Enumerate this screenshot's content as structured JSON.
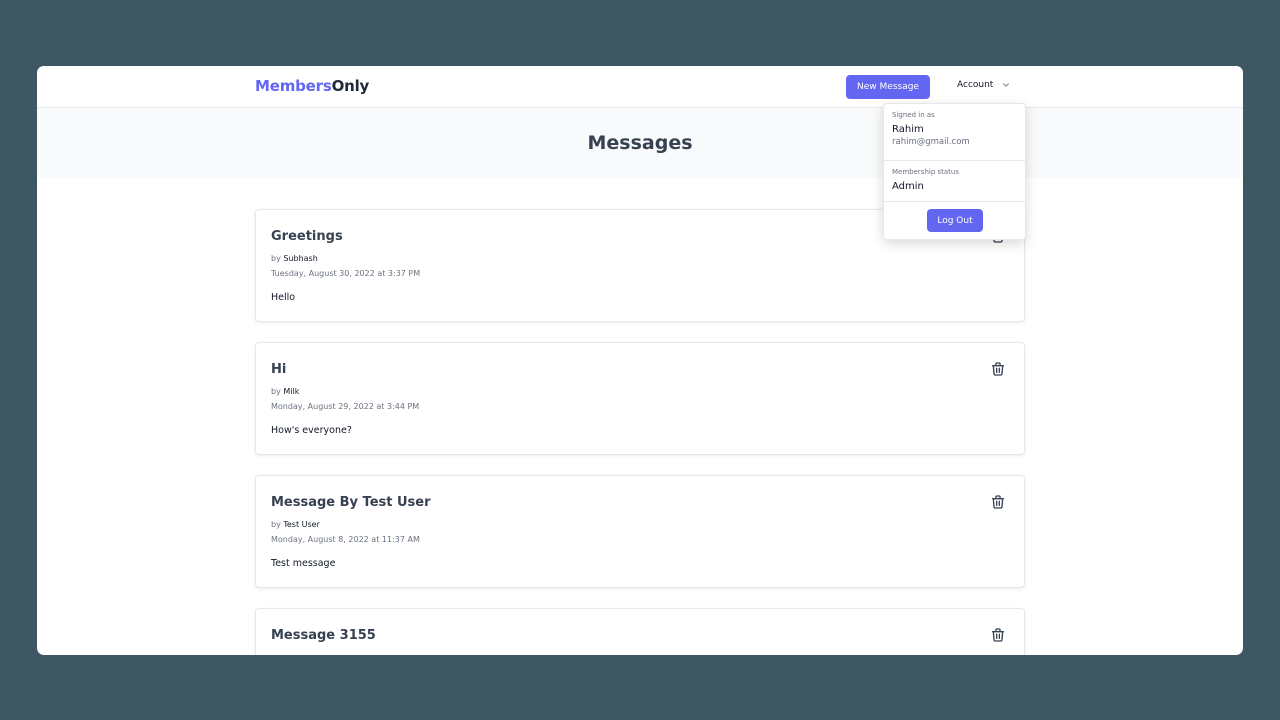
{
  "app": {
    "logo_part1": "Members",
    "logo_part2": "Only",
    "accent_color": "#6366f1"
  },
  "navbar": {
    "new_message_label": "New Message",
    "account_label": "Account",
    "account_icon": "chevron-down-icon"
  },
  "page": {
    "title": "Messages"
  },
  "account_menu": {
    "signed_in_label": "Signed in as",
    "user_name": "Rahim",
    "user_email": "rahim@gmail.com",
    "membership_label": "Membership status",
    "membership_value": "Admin",
    "logout_label": "Log Out"
  },
  "messages": [
    {
      "title": "Greetings",
      "by": "by",
      "author": "Subhash",
      "date": "Tuesday, August 30, 2022 at 3:37 PM",
      "body": "Hello",
      "icon": "trash-icon"
    },
    {
      "title": "Hi",
      "by": "by",
      "author": "Milk",
      "date": "Monday, August 29, 2022 at 3:44 PM",
      "body": "How's everyone?",
      "icon": "trash-icon"
    },
    {
      "title": "Message By Test User",
      "by": "by",
      "author": "Test User",
      "date": "Monday, August 8, 2022 at 11:37 AM",
      "body": "Test message",
      "icon": "trash-icon"
    },
    {
      "title": "Message 3155",
      "by": "",
      "author": "",
      "date": "",
      "body": "",
      "icon": "trash-icon"
    }
  ]
}
